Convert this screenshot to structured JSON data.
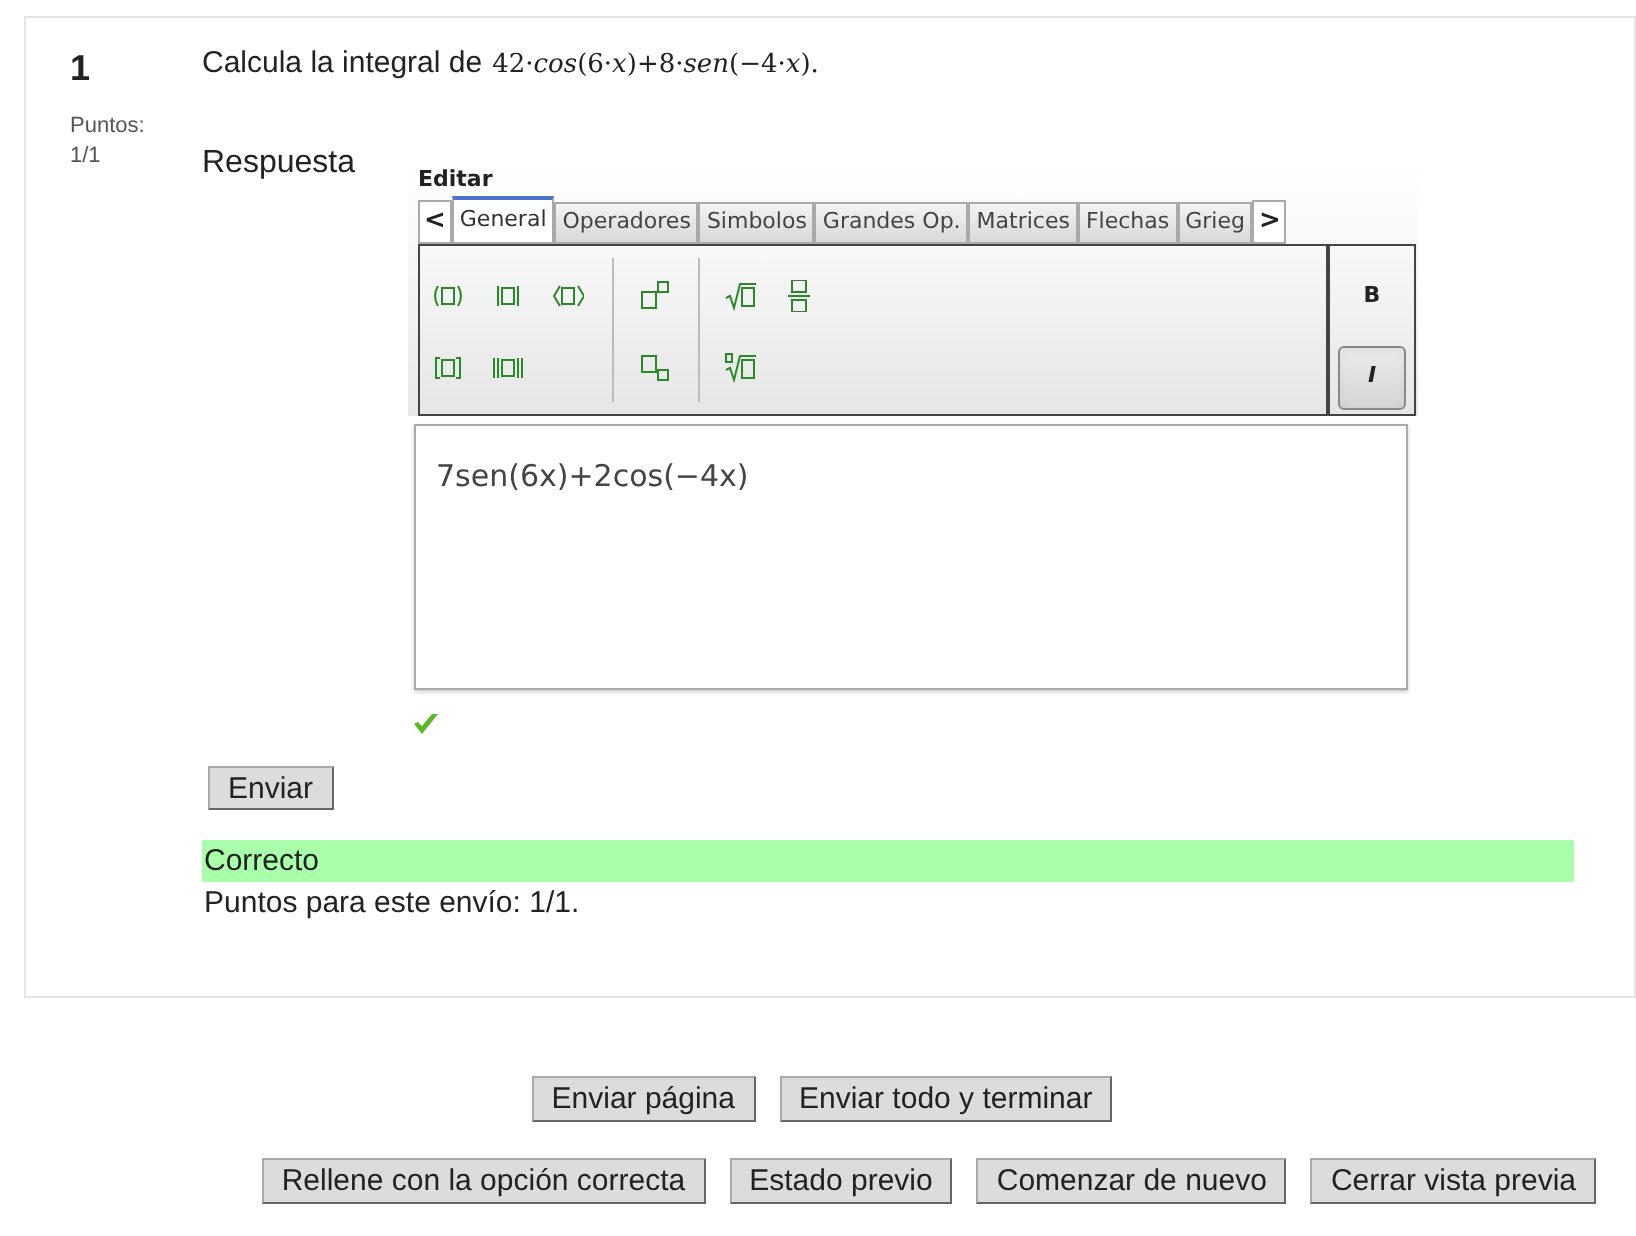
{
  "question": {
    "number": "1",
    "points_label": "Puntos:",
    "points_value": "1/1",
    "prompt": "Calcula la integral de",
    "formula": "42·*cos*(6·*x*)+8·*sen*(−4·*x*)."
  },
  "answer_label": "Respuesta",
  "editor": {
    "title": "Editar",
    "scroll_left": "<",
    "scroll_right": ">",
    "tabs": [
      {
        "label": "General",
        "selected": true
      },
      {
        "label": "Operadores",
        "selected": false
      },
      {
        "label": "Simbolos",
        "selected": false
      },
      {
        "label": "Grandes Op.",
        "selected": false
      },
      {
        "label": "Matrices",
        "selected": false
      },
      {
        "label": "Flechas",
        "selected": false
      },
      {
        "label": "Grieg",
        "selected": false
      }
    ],
    "style_buttons": [
      {
        "label": "B",
        "kind": "bold",
        "selected": false
      },
      {
        "label": "I",
        "kind": "italic",
        "selected": true
      }
    ],
    "value": "7sen(6x)+2cos(−4x)"
  },
  "correct": true,
  "submit_button": "Enviar",
  "feedback": {
    "status": "Correcto",
    "score": "Puntos para este envío: 1/1."
  },
  "page_buttons": [
    "Enviar página",
    "Enviar todo y terminar"
  ],
  "preview_buttons": [
    "Rellene con la opción correcta",
    "Estado previo",
    "Comenzar de nuevo",
    "Cerrar vista previa"
  ]
}
